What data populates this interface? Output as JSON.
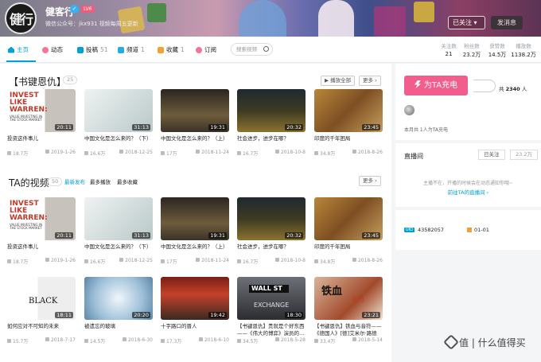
{
  "header": {
    "username": "健客行",
    "verified_icon": "verified-icon",
    "level": "LV6",
    "signature": "微信公众号：jkx931 视频每周五更新",
    "avatar_text": "健行",
    "follow_button": "已关注 ▾",
    "message_button": "发消息"
  },
  "nav": {
    "items": [
      {
        "label": "主页",
        "count": "",
        "icon": "home-icon"
      },
      {
        "label": "动态",
        "count": "",
        "icon": "dynamic-icon"
      },
      {
        "label": "投稿",
        "count": "51",
        "icon": "upload-icon"
      },
      {
        "label": "频道",
        "count": "1",
        "icon": "channel-icon"
      },
      {
        "label": "收藏",
        "count": "1",
        "icon": "favorite-icon"
      },
      {
        "label": "订阅",
        "count": "",
        "icon": "subscribe-icon"
      }
    ],
    "search_placeholder": "搜索视频",
    "stats": [
      {
        "key": "关注数",
        "value": "21"
      },
      {
        "key": "粉丝数",
        "value": "23.2万"
      },
      {
        "key": "获赞数",
        "value": "14.5万"
      },
      {
        "key": "播放数",
        "value": "1138.2万"
      }
    ]
  },
  "section1": {
    "title": "【书键恩仇】",
    "count": "25",
    "play_all": "▶ 播放全部",
    "more": "更多 ›"
  },
  "section2": {
    "title": "TA的视频",
    "count": "50",
    "tabs": [
      "最新发布",
      "最多播放",
      "最多收藏"
    ],
    "more": "更多 ›"
  },
  "row1": [
    {
      "title": "投资这件事儿",
      "duration": "20:11",
      "views": "18.7万",
      "date": "2019-1-26"
    },
    {
      "title": "中国文化是怎么来的？（下）",
      "duration": "31:13",
      "views": "16.6万",
      "date": "2018-12-25"
    },
    {
      "title": "中国文化是怎么来的？（上）",
      "duration": "19:31",
      "views": "17万",
      "date": "2018-11-24"
    },
    {
      "title": "社会进步，进步在哪？",
      "duration": "20:32",
      "views": "16.7万",
      "date": "2018-10-8"
    },
    {
      "title": "印度的千年困局",
      "duration": "23:45",
      "views": "34.8万",
      "date": "2018-8-26"
    }
  ],
  "row2": [
    {
      "title": "投资这件事儿",
      "duration": "20:11",
      "views": "18.7万",
      "date": "2019-1-26"
    },
    {
      "title": "中国文化是怎么来的？（下）",
      "duration": "31:13",
      "views": "16.6万",
      "date": "2018-12-25"
    },
    {
      "title": "中国文化是怎么来的？（上）",
      "duration": "19:31",
      "views": "17万",
      "date": "2018-11-24"
    },
    {
      "title": "社会进步，进步在哪？",
      "duration": "20:32",
      "views": "16.7万",
      "date": "2018-10-8"
    },
    {
      "title": "印度的千年困局",
      "duration": "23:45",
      "views": "34.8万",
      "date": "2018-8-26"
    }
  ],
  "row3": [
    {
      "title": "如何应对不可知的未来",
      "duration": "18:11",
      "views": "15.7万",
      "date": "2018-7-17"
    },
    {
      "title": "被遗忘的玻璃",
      "duration": "20:20",
      "views": "14.5万",
      "date": "2018-6-30"
    },
    {
      "title": "十字路口的晋人",
      "duration": "19:42",
      "views": "17.3万",
      "date": "2018-6-10"
    },
    {
      "title": "【书键恩仇】贵就是个好东西——《伟大的博弈》演员的…",
      "duration": "18:30",
      "views": "34.5万",
      "date": "2018-5-28"
    },
    {
      "title": "【书键恩仇】铁血与音符——《德国人》[德]艾米尔·路德维…",
      "duration": "23:21",
      "views": "33.4万",
      "date": "2018-5-14"
    }
  ],
  "thumb_text": {
    "invest_title": "INVEST LIKE WARREN:",
    "invest_sub": "VALUE INVESTING IN THE STOCK MARKET",
    "black_swan": "BLACK",
    "wall_st": "WALL ST",
    "exchange": "EXCHANGE",
    "iron_blood": "铁血",
    "notes": "音符"
  },
  "sidebar": {
    "charge_button": "为TA充电",
    "charge_icon": "lightning-icon",
    "fans_prefix": "共 ",
    "fans_count": "2340",
    "fans_suffix": " 人",
    "month_text": "本月共 1人为TA充电",
    "live_title": "直播间",
    "live_followed": "已关注",
    "live_followers": "23.2万",
    "live_message": "主播不在，开播的时候会在动态通知你哦~",
    "live_link": "前往TA的直播间 ›",
    "uid_label": "UID",
    "uid_value": "43582057",
    "birthday_value": "01-01"
  },
  "watermark": "值 | 什么值得买",
  "colors": {
    "accent": "#00a1d6",
    "pink": "#f25d8e"
  }
}
